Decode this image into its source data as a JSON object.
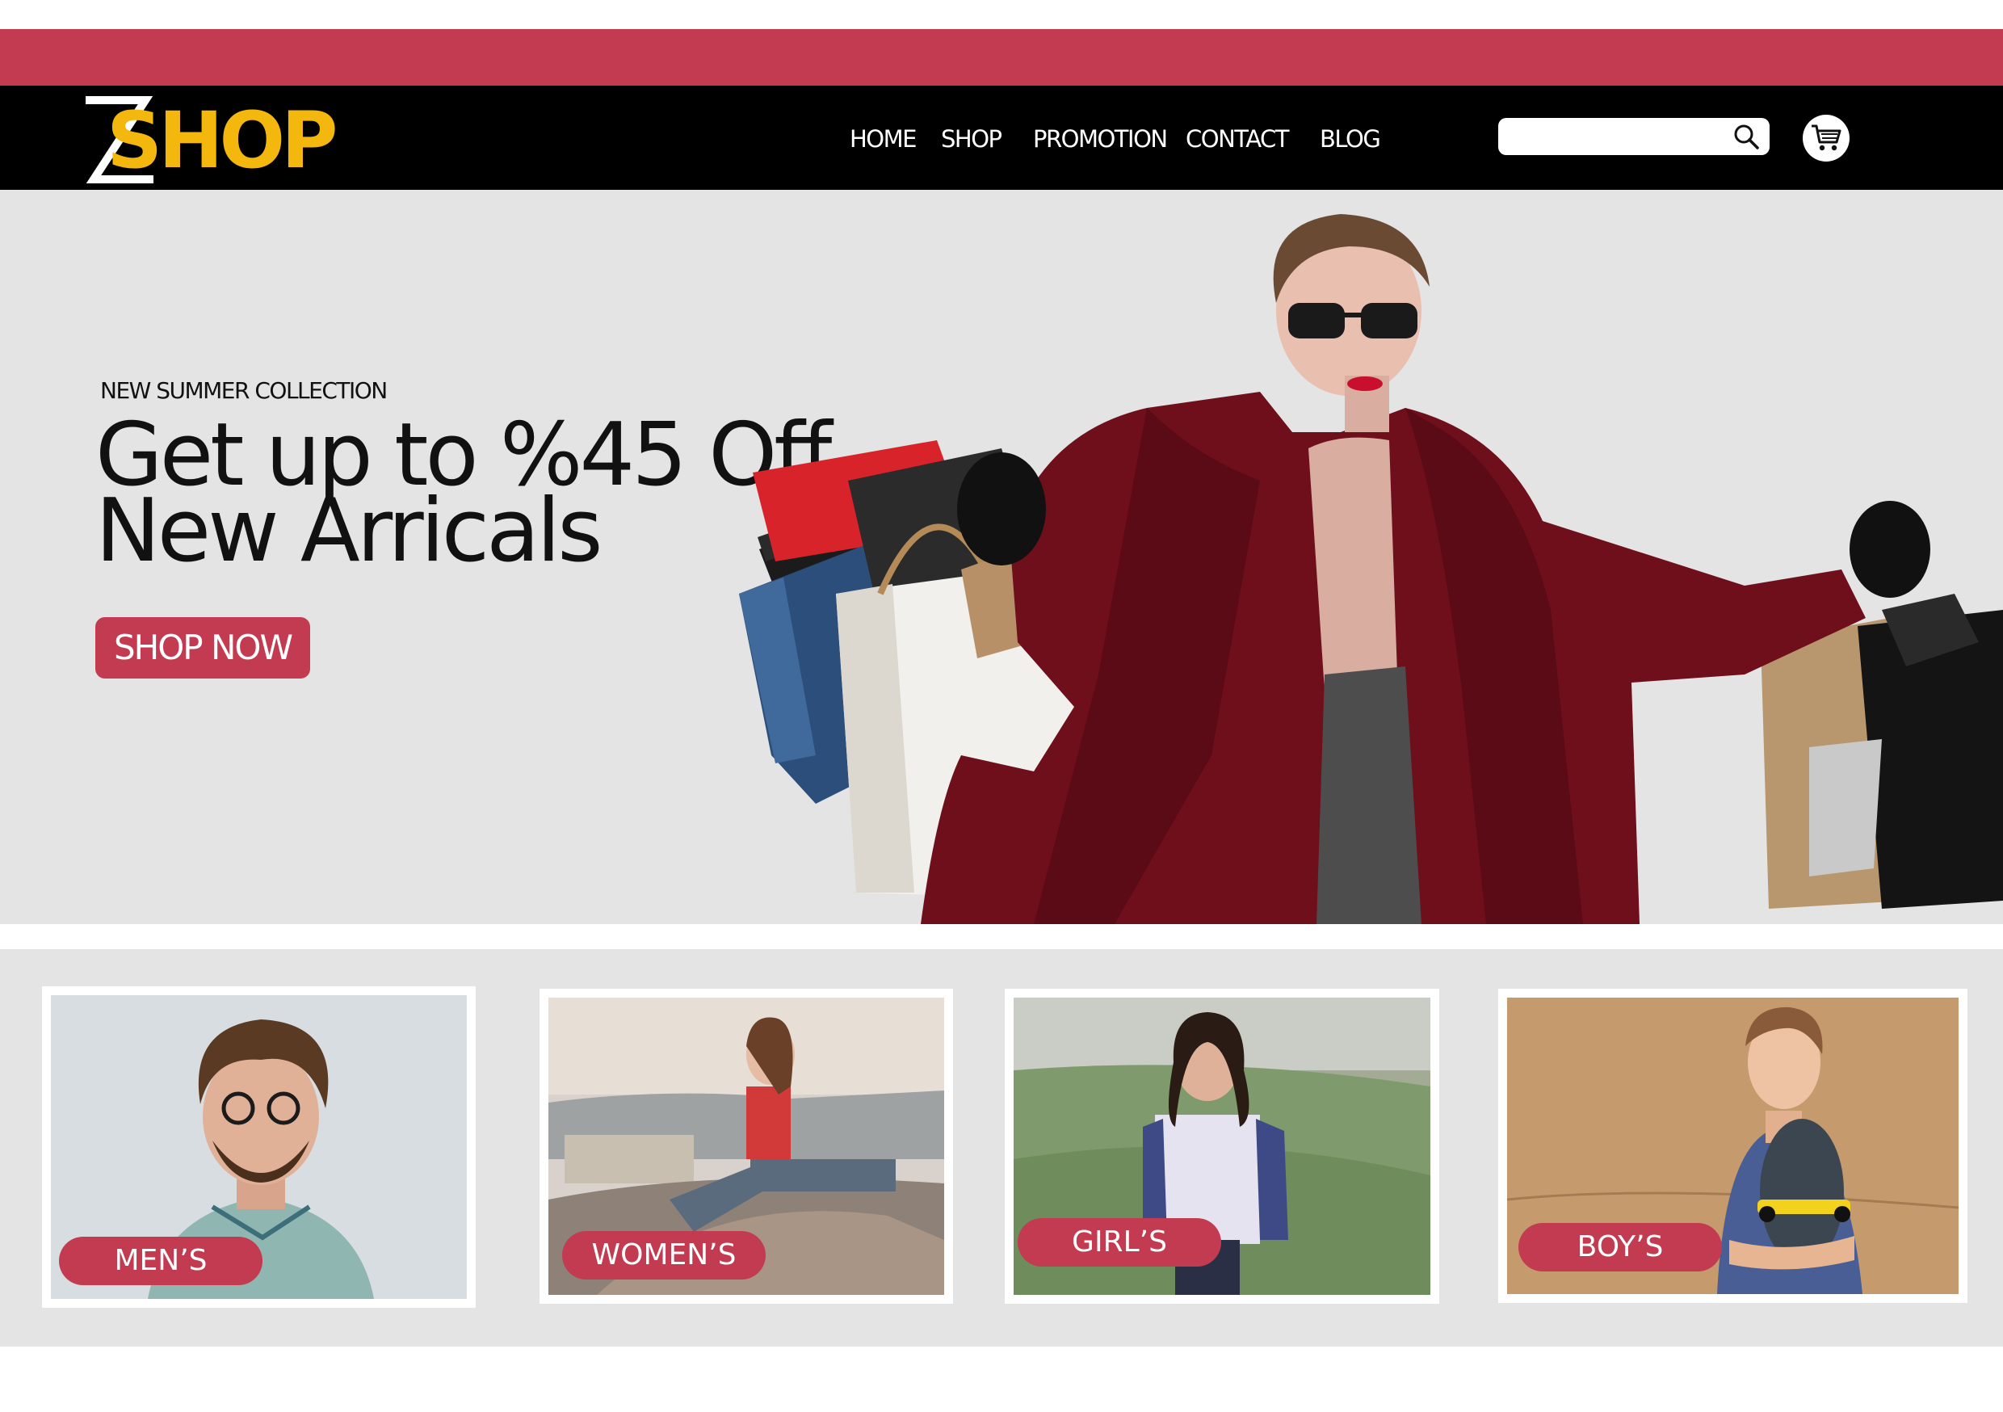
{
  "colors": {
    "accent": "#c23b50",
    "navbar": "#000000",
    "logo_yellow": "#f3b70d",
    "hero_bg": "#e4e4e4"
  },
  "brand": {
    "logo_text": "SHOP",
    "logo_letter": "Z"
  },
  "nav": {
    "items": [
      "HOME",
      "SHOP",
      "PROMOTION",
      "CONTACT",
      "BLOG"
    ]
  },
  "search": {
    "value": "",
    "icon": "search-icon"
  },
  "cart": {
    "icon": "shopping-cart-icon"
  },
  "hero": {
    "eyebrow": "NEW SUMMER COLLECTION",
    "title_line1": "Get up to %45 Off",
    "title_line2": "New Arricals",
    "cta": "SHOP NOW"
  },
  "categories": [
    {
      "label": "MEN’S"
    },
    {
      "label": "WOMEN’S"
    },
    {
      "label": "GIRL’S"
    },
    {
      "label": "BOY’S"
    }
  ]
}
